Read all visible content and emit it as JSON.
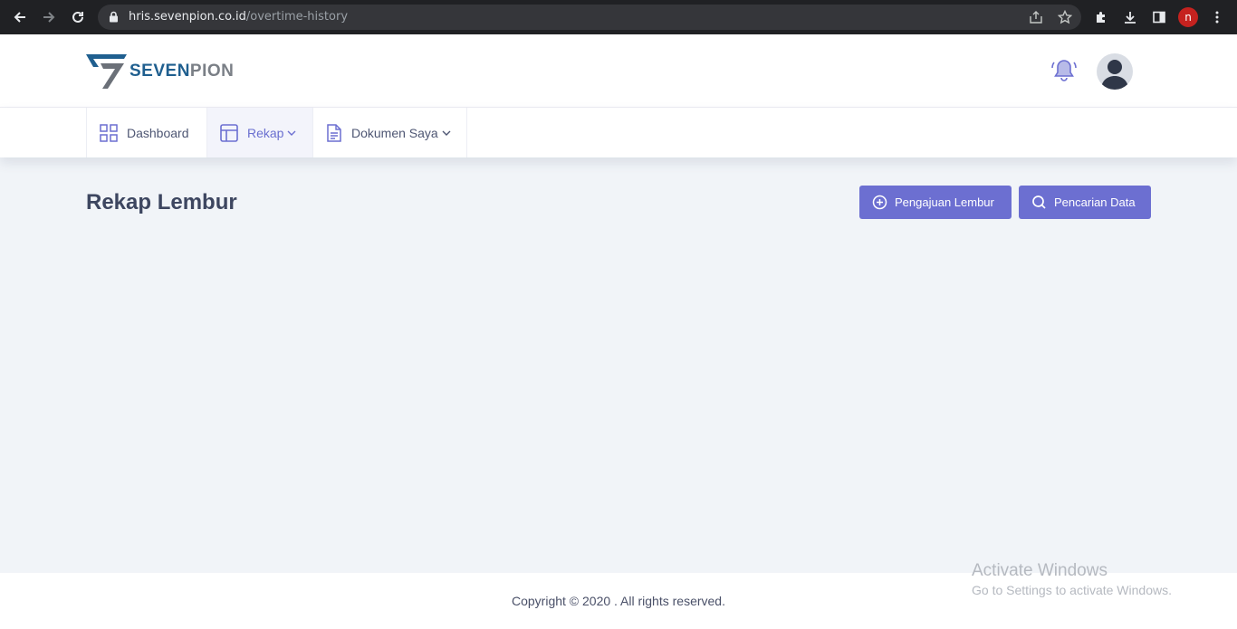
{
  "browser": {
    "url_host": "hris.sevenpion.co.id",
    "url_path": "/overtime-history",
    "profile_initial": "n"
  },
  "header": {
    "logo_seven": "SEVEN",
    "logo_pion": "PION"
  },
  "menu": {
    "items": [
      {
        "label": "Dashboard",
        "icon": "grid-icon"
      },
      {
        "label": "Rekap",
        "icon": "layout-icon",
        "dropdown": true,
        "active": true
      },
      {
        "label": "Dokumen Saya",
        "icon": "document-icon",
        "dropdown": true
      }
    ]
  },
  "main": {
    "title": "Rekap Lembur",
    "buttons": {
      "submit_overtime": "Pengajuan Lembur",
      "search_data": "Pencarian Data"
    }
  },
  "footer": {
    "copyright": "Copyright © 2020 . All rights reserved."
  },
  "watermark": {
    "line1": "Activate Windows",
    "line2": "Go to Settings to activate Windows."
  },
  "colors": {
    "accent": "#6c6fd1",
    "title": "#3d4660",
    "background": "#f1f4f8"
  }
}
